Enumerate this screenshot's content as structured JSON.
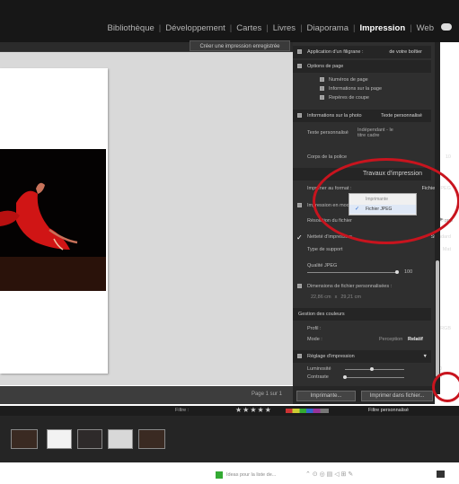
{
  "modules": [
    "Bibliothèque",
    "Développement",
    "Cartes",
    "Livres",
    "Diaporama",
    "Impression",
    "Web"
  ],
  "active_module": "Impression",
  "toolbar": {
    "save_button": "Créer une impression enregistrée"
  },
  "panel": {
    "identity_plate": {
      "label": "Application d'un filigrane :",
      "value": "de votre boîtier"
    },
    "page_options": {
      "title": "Options de page",
      "items": [
        "Numéros de page",
        "Informations sur la page",
        "Repères de coupe"
      ]
    },
    "photo_info": {
      "title": "Informations sur la photo",
      "value": "Texte personnalisé"
    },
    "custom_text": {
      "label": "Texte personnalisé",
      "value": "Indépendant - le titre cadre"
    },
    "font_size": {
      "label": "Corps de la police",
      "value": "10"
    },
    "print_job": {
      "title": "Travaux d'impression"
    },
    "print_to": {
      "label": "Imprimer au format :",
      "value": "Fichier JPEG"
    },
    "popup_options": [
      "Imprimante",
      "Fichier JPEG"
    ],
    "draft_mode": {
      "label": "Impression en mode brouillon"
    },
    "file_resolution": {
      "label": "Résolution du fichier",
      "value": "300",
      "unit": "ppp"
    },
    "sharpening": {
      "label": "Netteté d'impression",
      "value": "Standard"
    },
    "media_type": {
      "label": "Type de support",
      "value": "Mat"
    },
    "jpeg_quality": {
      "label": "Qualité JPEG",
      "value": "100"
    },
    "custom_dims": {
      "label": "Dimensions de fichier personnalisées :",
      "width": "22,86 cm",
      "height": "29,21 cm"
    },
    "color_management": {
      "title": "Gestion des couleurs"
    },
    "profile": {
      "label": "Profil :",
      "value": "sRGB"
    },
    "intent": {
      "label": "Mode :",
      "options": [
        "Perception",
        "Relatif"
      ],
      "selected": "Relatif"
    },
    "print_adjust": {
      "title": "Réglage d'impression"
    },
    "brightness": {
      "label": "Luminosité",
      "value": "0"
    },
    "contrast": {
      "label": "Contraste",
      "value": "0"
    }
  },
  "status": {
    "page": "Page 1 sur 1"
  },
  "buttons": {
    "printer": "Imprimante...",
    "print_to_file": "Imprimer dans fichier..."
  },
  "filmstrip": {
    "filter_label": "Filtre :",
    "preset": "Filtre personnalisé"
  },
  "taskbar": {
    "notification": "Ideas pour la liste de..."
  },
  "colors": {
    "accent_red": "#c8141e",
    "panel_bg": "#2f2f2f",
    "topbar_bg": "#171717"
  },
  "chart_data": null
}
